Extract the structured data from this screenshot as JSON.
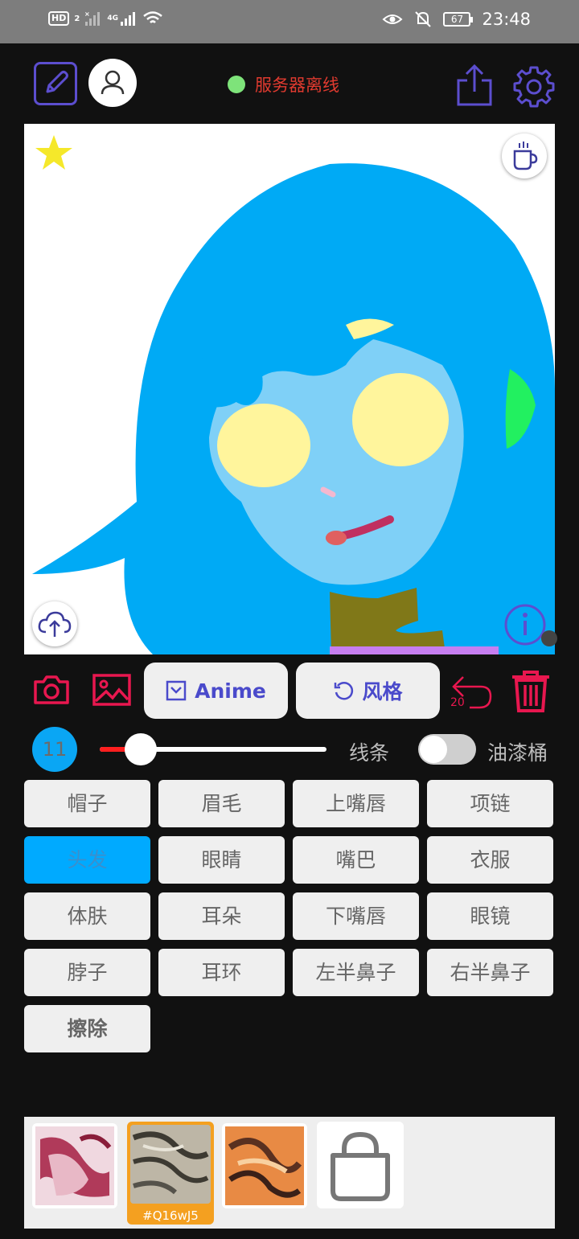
{
  "status_bar": {
    "network_badge": "HD",
    "network_sub": "2",
    "network_4g": "4G",
    "battery": "67",
    "time": "23:48"
  },
  "header": {
    "server_status": "服务器离线",
    "status_color": "#7ee37a"
  },
  "actions": {
    "anime_label": "Anime",
    "style_label": "风格",
    "undo_count": "20"
  },
  "brush": {
    "size": "11",
    "slider_fraction": 0.18,
    "lines_label": "线条",
    "bucket_label": "油漆桶",
    "bucket_enabled": false
  },
  "parts": [
    {
      "label": "帽子"
    },
    {
      "label": "眉毛"
    },
    {
      "label": "上嘴唇"
    },
    {
      "label": "项链"
    },
    {
      "label": "头发",
      "active": true
    },
    {
      "label": "眼睛"
    },
    {
      "label": "嘴巴"
    },
    {
      "label": "衣服"
    },
    {
      "label": "体肤"
    },
    {
      "label": "耳朵"
    },
    {
      "label": "下嘴唇"
    },
    {
      "label": "眼镜"
    },
    {
      "label": "脖子"
    },
    {
      "label": "耳环"
    },
    {
      "label": "左半鼻子"
    },
    {
      "label": "右半鼻子"
    },
    {
      "label": "擦除",
      "bold": true
    }
  ],
  "tray": {
    "selected_code": "#Q16wJ5"
  },
  "colors": {
    "accent": "#5c4ecf",
    "danger": "#e8174f",
    "active_part": "#00aaff"
  }
}
